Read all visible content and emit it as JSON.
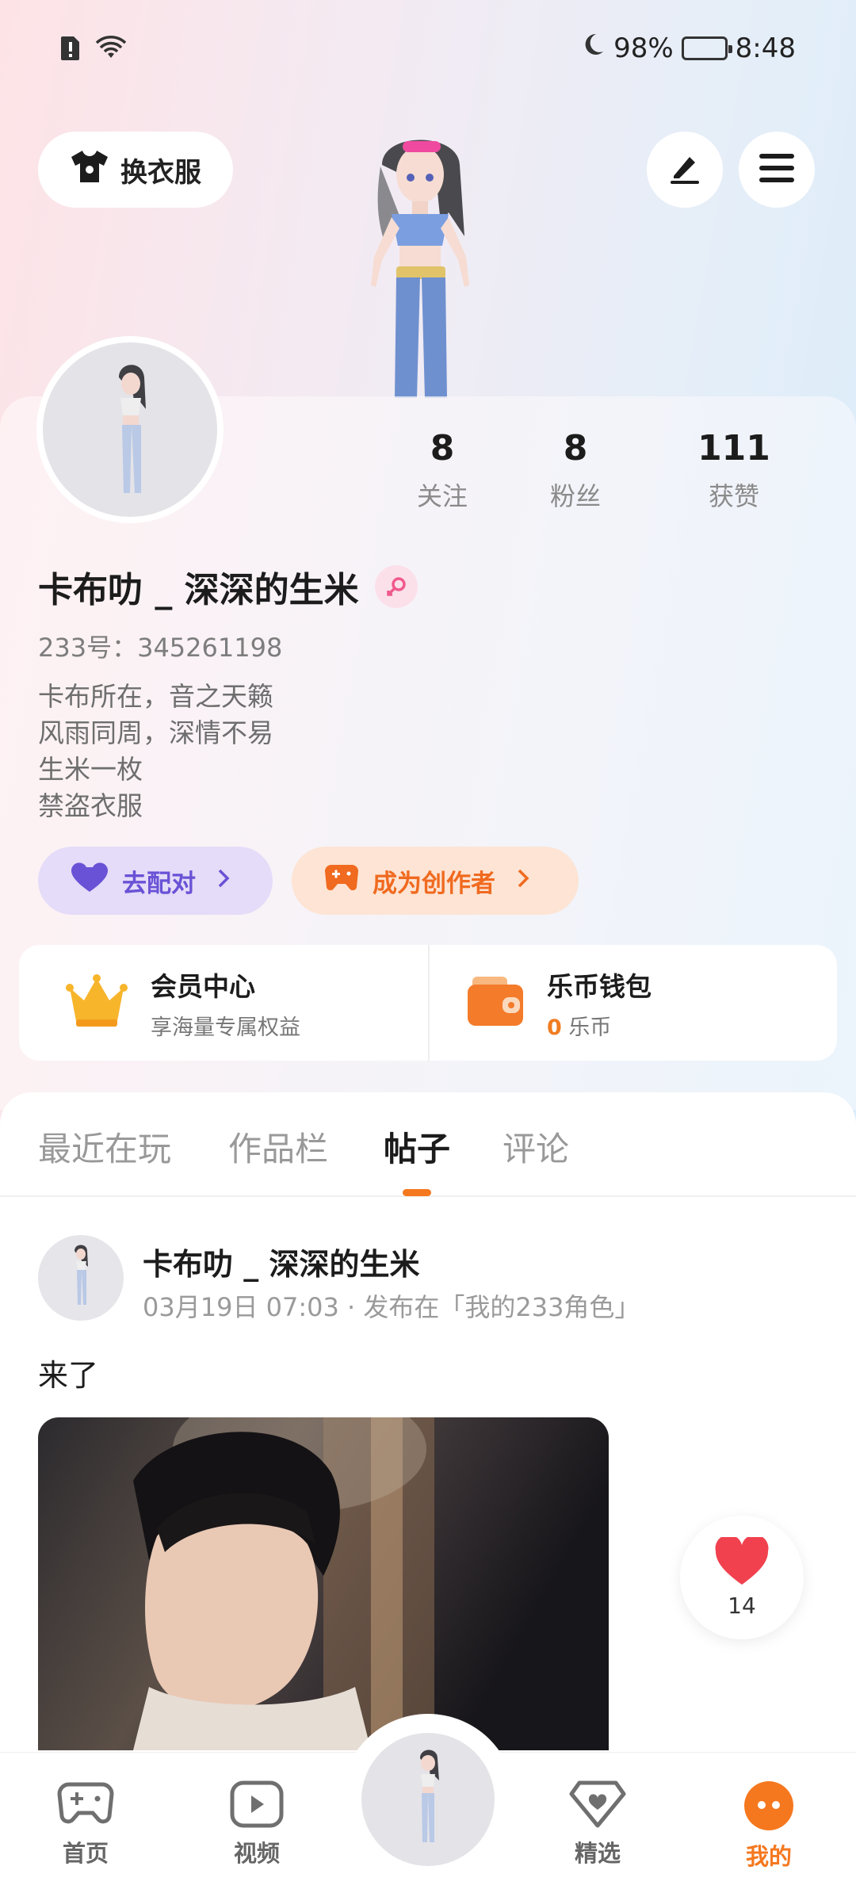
{
  "status_bar": {
    "battery_percent": "98%",
    "time": "8:48"
  },
  "header": {
    "outfit_button_label": "换衣服"
  },
  "stats": [
    {
      "value": "8",
      "label": "关注"
    },
    {
      "value": "8",
      "label": "粉丝"
    },
    {
      "value": "111",
      "label": "获赞"
    }
  ],
  "profile": {
    "nickname": "卡布叻 _ 深深的生米",
    "uid": "233号：345261198",
    "bio": [
      "卡布所在，音之天籁",
      "风雨同周，深情不易",
      "生米一枚",
      "禁盗衣服"
    ]
  },
  "actions": {
    "match_label": "去配对",
    "creator_label": "成为创作者"
  },
  "cards": {
    "vip_title": "会员中心",
    "vip_subtitle": "享海量专属权益",
    "wallet_title": "乐币钱包",
    "wallet_amount": "0",
    "wallet_unit": "乐币"
  },
  "tabs": [
    "最近在玩",
    "作品栏",
    "帖子",
    "评论"
  ],
  "active_tab_index": 2,
  "post": {
    "author": "卡布叻 _ 深深的生米",
    "meta": "03月19日 07:03 · 发布在「我的233角色」",
    "text": "来了",
    "like_count": "14"
  },
  "bottom_nav": {
    "home": "首页",
    "video": "视频",
    "featured": "精选",
    "mine": "我的"
  },
  "colors": {
    "accent": "#f5781f",
    "match_purple": "#6a52d6",
    "like_red": "#f1414f"
  }
}
